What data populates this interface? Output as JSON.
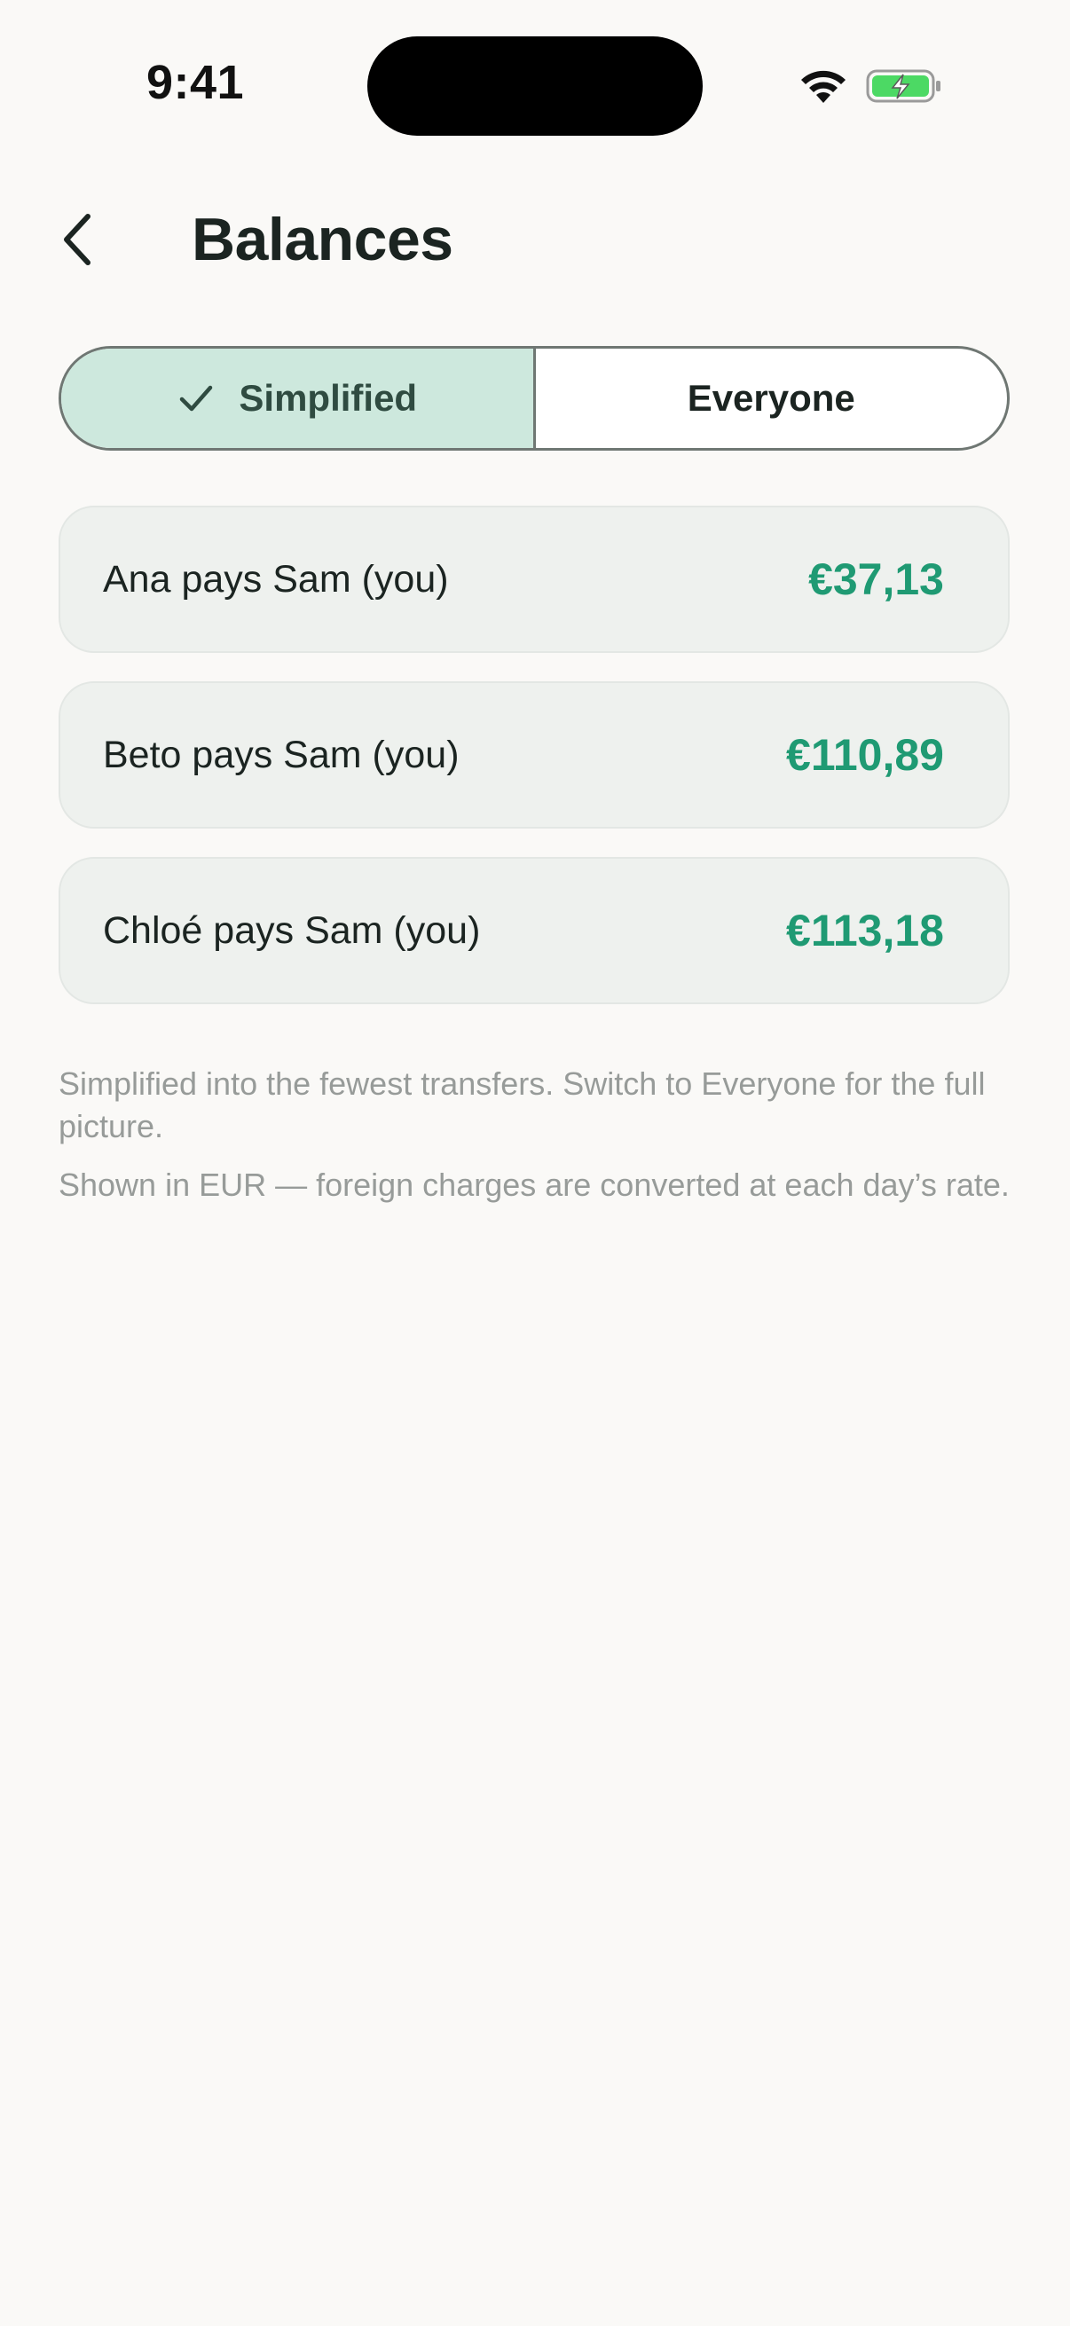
{
  "status_bar": {
    "time": "9:41",
    "icons": [
      "wifi-icon",
      "battery-charging-icon"
    ]
  },
  "header": {
    "back_icon": "chevron-left-icon",
    "title": "Balances"
  },
  "segmented_control": {
    "options": [
      {
        "label": "Simplified",
        "selected": true,
        "icon": "checkmark-icon"
      },
      {
        "label": "Everyone",
        "selected": false
      }
    ]
  },
  "balances": [
    {
      "label": "Ana pays Sam (you)",
      "amount": "€37,13"
    },
    {
      "label": "Beto pays Sam (you)",
      "amount": "€110,89"
    },
    {
      "label": "Chloé pays Sam (you)",
      "amount": "€113,18"
    }
  ],
  "footnotes": [
    "Simplified into the fewest transfers. Switch to Everyone for the full picture.",
    "Shown in EUR — foreign charges are converted at each day’s rate."
  ],
  "colors": {
    "background": "#faf9f7",
    "accent": "#1f9a73",
    "selected_segment": "#cde8dd",
    "card_background": "#eef1ee",
    "battery_fill": "#4cd964"
  }
}
